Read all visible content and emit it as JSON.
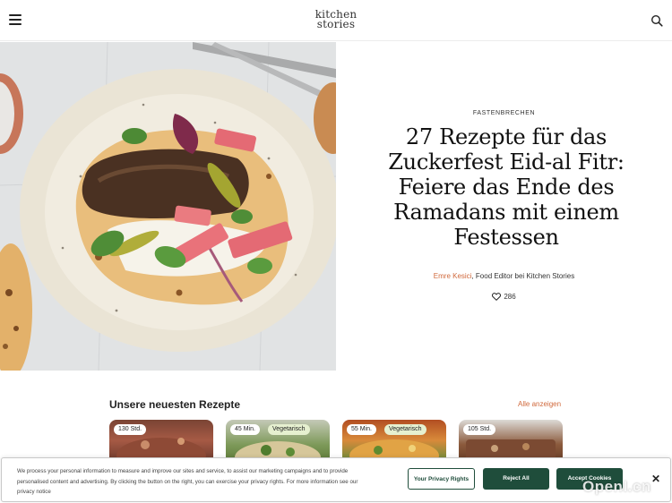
{
  "header": {
    "logo_line1": "kitchen",
    "logo_line2": "stories"
  },
  "hero": {
    "kicker": "FASTENBRECHEN",
    "headline": "27 Rezepte für das Zuckerfest Eid-al Fitr: Feiere das Ende des Ramadans mit einem Festessen",
    "author": "Emre Kesici",
    "author_role": ", Food Editor bei Kitchen Stories",
    "likes": "286"
  },
  "latest": {
    "title": "Unsere neuesten Rezepte",
    "see_all": "Alle anzeigen",
    "cards": [
      {
        "time": "130 Std.",
        "tag": ""
      },
      {
        "time": "45 Min.",
        "tag": "Vegetarisch"
      },
      {
        "time": "55 Min.",
        "tag": "Vegetarisch"
      },
      {
        "time": "105 Std.",
        "tag": ""
      }
    ]
  },
  "cookie": {
    "text": "We process your personal information to measure and improve our sites and service, to assist our marketing campaigns and to provide personalised content and advertising. By clicking the button on the right, you can exercise your privacy rights. For more information see our privacy notice",
    "privacy_rights": "Your Privacy Rights",
    "reject_all": "Reject All",
    "accept_cookies": "Accept Cookies",
    "close": "✕"
  },
  "watermark": "OpenI.cn",
  "colors": {
    "accent": "#d0693c",
    "cookie_button": "#1f4d3b"
  },
  "icons": [
    "menu-icon",
    "search-icon",
    "heart-icon",
    "close-icon"
  ]
}
